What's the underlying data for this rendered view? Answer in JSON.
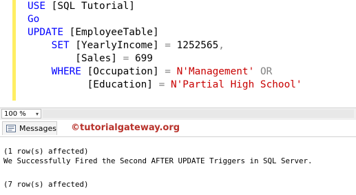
{
  "editor": {
    "lines": [
      {
        "parts": [
          {
            "t": "USE ",
            "c": "kw"
          },
          {
            "t": "[SQL Tutorial]",
            "c": ""
          }
        ]
      },
      {
        "parts": [
          {
            "t": "Go",
            "c": "kw"
          }
        ]
      },
      {
        "parts": [
          {
            "t": "UPDATE ",
            "c": "kw"
          },
          {
            "t": "[EmployeeTable]",
            "c": ""
          }
        ]
      },
      {
        "parts": [
          {
            "t": "    SET ",
            "c": "kw"
          },
          {
            "t": "[YearlyIncome] ",
            "c": ""
          },
          {
            "t": "=",
            "c": "op"
          },
          {
            "t": " 1252565",
            "c": ""
          },
          {
            "t": ",",
            "c": "op"
          }
        ]
      },
      {
        "parts": [
          {
            "t": "        [Sales] ",
            "c": ""
          },
          {
            "t": "=",
            "c": "op"
          },
          {
            "t": " 699",
            "c": ""
          }
        ]
      },
      {
        "parts": [
          {
            "t": "    WHERE ",
            "c": "kw"
          },
          {
            "t": "[Occupation] ",
            "c": ""
          },
          {
            "t": "=",
            "c": "op"
          },
          {
            "t": " ",
            "c": ""
          },
          {
            "t": "N'Management'",
            "c": "str"
          },
          {
            "t": " ",
            "c": ""
          },
          {
            "t": "OR",
            "c": "op"
          }
        ]
      },
      {
        "parts": [
          {
            "t": "          [Education] ",
            "c": ""
          },
          {
            "t": "=",
            "c": "op"
          },
          {
            "t": " ",
            "c": ""
          },
          {
            "t": "N'Partial High School'",
            "c": "str"
          }
        ]
      }
    ]
  },
  "statusbar": {
    "zoom_label": "100 %",
    "zoom_arrow": "▾"
  },
  "results": {
    "tab_label": "Messages",
    "watermark": "©tutorialgateway.org",
    "messages": [
      "(1 row(s) affected)",
      "We Successfully Fired the Second AFTER UPDATE Triggers in SQL Server.",
      "",
      "(7 row(s) affected)"
    ]
  },
  "colors": {
    "keyword": "#0000ff",
    "string": "#c80000",
    "operator": "#808080",
    "change_margin": "#ffee62",
    "watermark": "#b8322b"
  }
}
